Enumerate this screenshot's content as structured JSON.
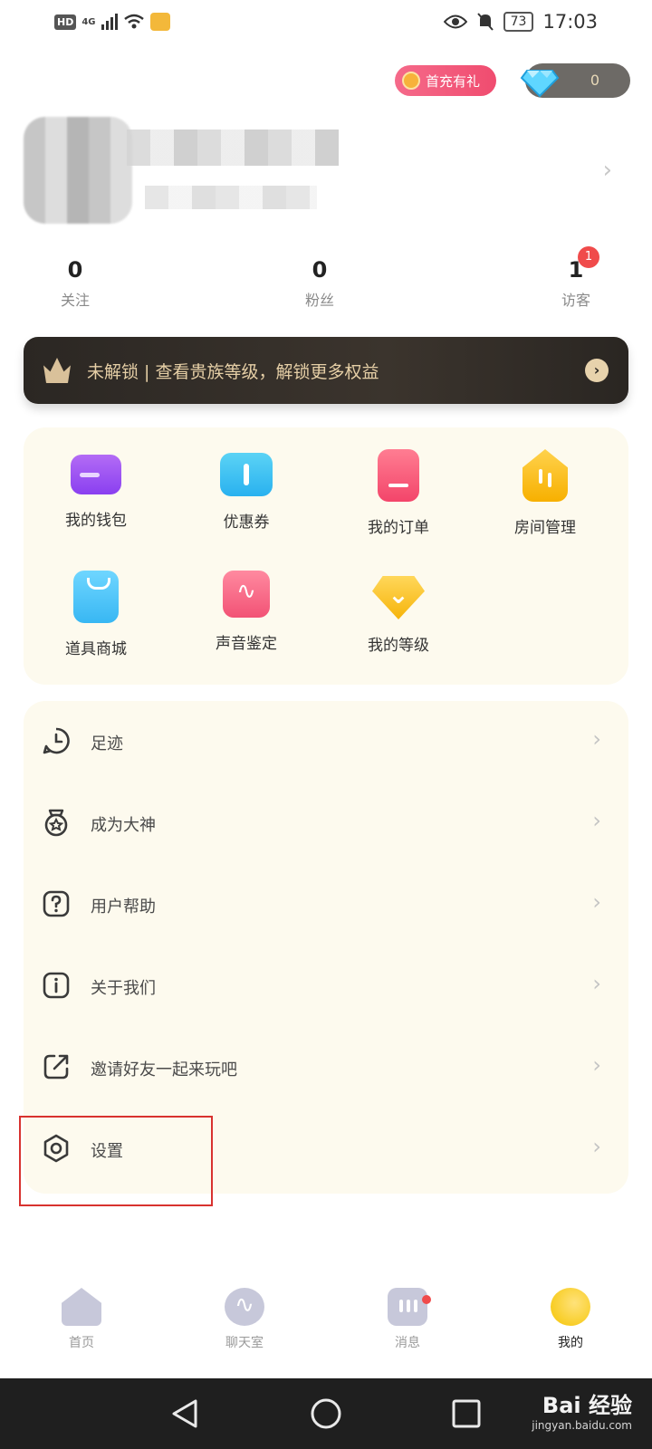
{
  "status_bar": {
    "hd": "HD",
    "network": "4G",
    "battery": "73",
    "time": "17:03"
  },
  "top_actions": {
    "recharge_label": "首充有礼",
    "diamond_count": "0"
  },
  "stats": [
    {
      "value": "0",
      "label": "关注"
    },
    {
      "value": "0",
      "label": "粉丝"
    },
    {
      "value": "1",
      "label": "访客",
      "badge": "1"
    }
  ],
  "noble_banner": {
    "text": "未解锁 | 查看贵族等级，解锁更多权益"
  },
  "grid": [
    {
      "label": "我的钱包",
      "icon": "wallet-icon"
    },
    {
      "label": "优惠券",
      "icon": "coupon-icon"
    },
    {
      "label": "我的订单",
      "icon": "order-icon"
    },
    {
      "label": "房间管理",
      "icon": "room-icon"
    },
    {
      "label": "道具商城",
      "icon": "shop-bag-icon"
    },
    {
      "label": "声音鉴定",
      "icon": "voice-wave-icon"
    },
    {
      "label": "我的等级",
      "icon": "level-gem-icon"
    }
  ],
  "menu": [
    {
      "label": "足迹",
      "icon": "clock-icon"
    },
    {
      "label": "成为大神",
      "icon": "medal-icon"
    },
    {
      "label": "用户帮助",
      "icon": "help-icon"
    },
    {
      "label": "关于我们",
      "icon": "info-icon"
    },
    {
      "label": "邀请好友一起来玩吧",
      "icon": "share-icon"
    },
    {
      "label": "设置",
      "icon": "settings-icon"
    }
  ],
  "tabs": [
    {
      "label": "首页",
      "icon": "home-icon",
      "active": false
    },
    {
      "label": "聊天室",
      "icon": "chatroom-icon",
      "active": false
    },
    {
      "label": "消息",
      "icon": "message-icon",
      "active": false
    },
    {
      "label": "我的",
      "icon": "mine-icon",
      "active": true
    }
  ],
  "watermark": {
    "brand": "Bai 经验",
    "url": "jingyan.baidu.com"
  }
}
